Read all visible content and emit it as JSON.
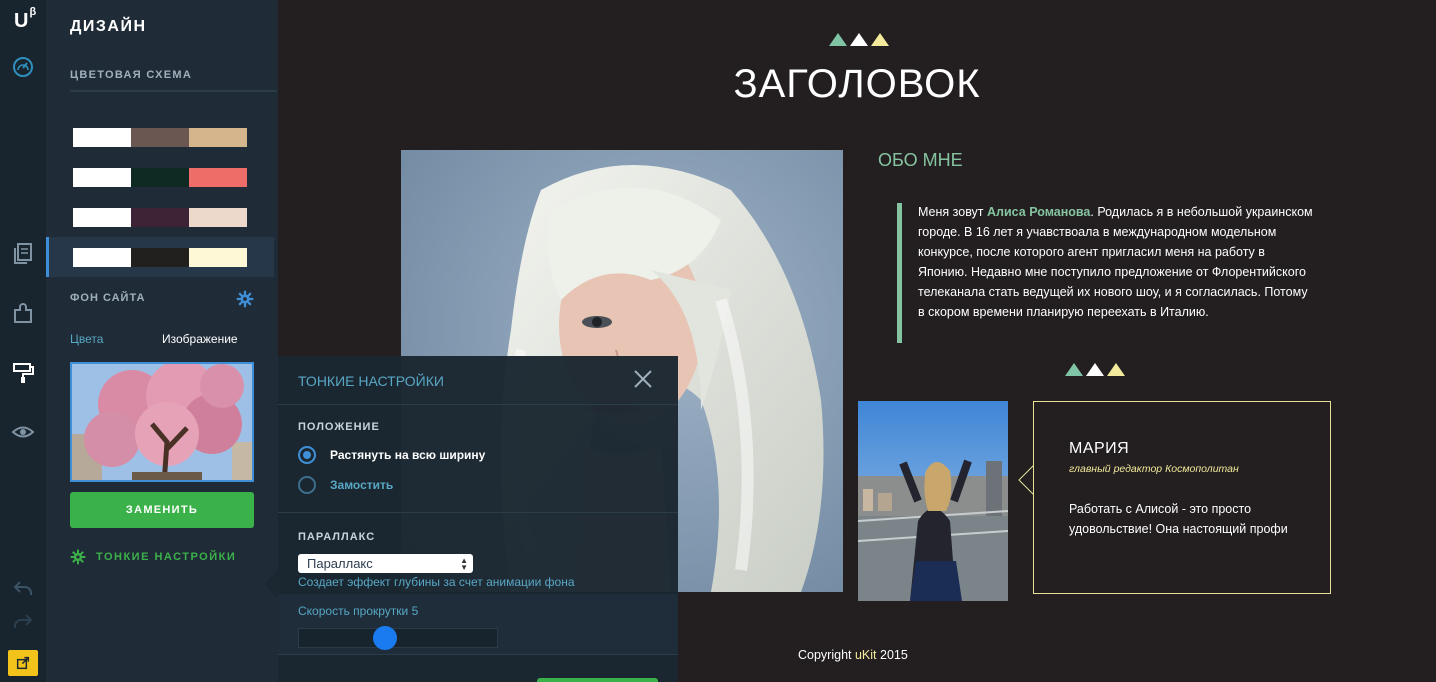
{
  "app": {
    "logo": "U",
    "logo_sup": "β"
  },
  "rail": {
    "icons": [
      "dashboard-icon",
      "pages-icon",
      "widgets-icon",
      "design-brush-icon",
      "preview-eye-icon",
      "undo-icon",
      "redo-icon",
      "publish-icon"
    ]
  },
  "panel": {
    "title": "ДИЗАЙН",
    "scheme_title": "ЦВЕТОВАЯ СХЕМА",
    "schemes": [
      {
        "colors": [
          "#ffffff",
          "#6b5751",
          "#d5b58b"
        ],
        "selected": false
      },
      {
        "colors": [
          "#ffffff",
          "#0e2a22",
          "#ef6d68"
        ],
        "selected": false
      },
      {
        "colors": [
          "#ffffff",
          "#3e2337",
          "#ecd9cb"
        ],
        "selected": false
      },
      {
        "colors": [
          "#ffffff",
          "#221f1f",
          "#fff8d6"
        ],
        "selected": true
      }
    ],
    "bg_title": "ФОН САЙТА",
    "tab_colors": "Цвета",
    "tab_image": "Изображение",
    "replace_btn": "ЗАМЕНИТЬ",
    "fine_link": "ТОНКИЕ НАСТРОЙКИ"
  },
  "popover": {
    "title": "ТОНКИЕ НАСТРОЙКИ",
    "position_title": "ПОЛОЖЕНИЕ",
    "options": [
      {
        "label": "Растянуть на всю ширину",
        "checked": true
      },
      {
        "label": "Замостить",
        "checked": false
      }
    ],
    "parallax_title": "ПАРАЛЛАКС",
    "parallax_value": "Параллакс",
    "parallax_hint": "Создает эффект глубины за счет анимации фона",
    "speed_label": "Скорость прокрутки 5",
    "speed_value": 5
  },
  "site": {
    "heading": "ЗАГОЛОВОК",
    "tri_colors": [
      "#7fc5a5",
      "#ffffff",
      "#f3ea9b"
    ],
    "about_title": "ОБО МНЕ",
    "bio_before": "Меня зовут ",
    "bio_name": "Алиса Романова",
    "bio_after": ". Родилась я в небольшой украинском городе. В 16 лет я учавствоала в международном модельном конкурсе, после которого агент пригласил меня на работу в Японию. Недавно мне поступило предложение от Флорентийского телеканала стать ведущей их нового шоу, и я согласилась. Потому в скором времени планирую переехать в Италию.",
    "testimonial": {
      "name": "МАРИЯ",
      "role": "главный редактор Космополитан",
      "text": "Работать с Алисой - это просто удовольствие! Она настоящий профи"
    },
    "footer_prefix": "Copyright ",
    "footer_brand": "uKit",
    "footer_year": " 2015"
  }
}
